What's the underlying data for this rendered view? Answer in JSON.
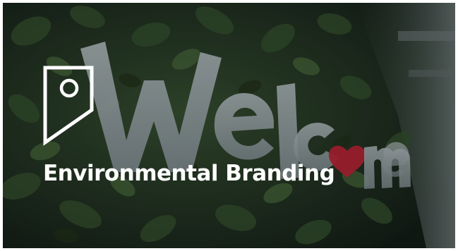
{
  "card": {
    "title": "Environmental Branding",
    "icon": "tag-icon",
    "sign_text": "Welcome",
    "colors": {
      "overlay": "#000000",
      "title": "#ffffff",
      "heart": "#d02a3c",
      "foliage": "#2e4a2c"
    }
  }
}
